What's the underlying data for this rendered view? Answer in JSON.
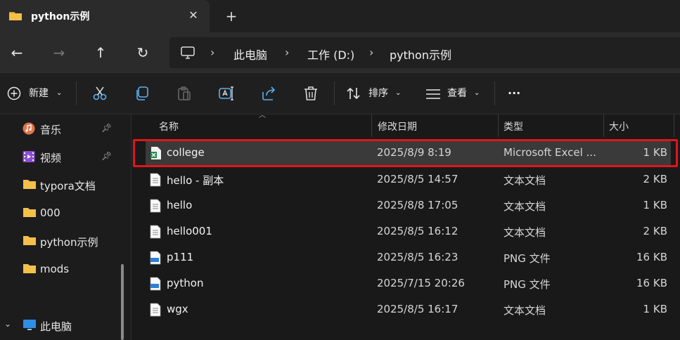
{
  "tab": {
    "title": "python示例",
    "close": "✕",
    "new": "+"
  },
  "nav": {
    "back": "←",
    "forward": "→",
    "up": "↑",
    "refresh": "↻"
  },
  "breadcrumb": {
    "items": [
      "此电脑",
      "工作 (D:)",
      "python示例"
    ],
    "sep": "›"
  },
  "toolbar": {
    "new_label": "新建",
    "sort_label": "排序",
    "view_label": "查看",
    "more": "···"
  },
  "sidebar": {
    "items": [
      {
        "label": "音乐",
        "icon": "music-icon",
        "pinned": true
      },
      {
        "label": "视频",
        "icon": "video-icon",
        "pinned": true
      },
      {
        "label": "typora文档",
        "icon": "folder-icon",
        "pinned": false
      },
      {
        "label": "000",
        "icon": "folder-icon",
        "pinned": false
      },
      {
        "label": "python示例",
        "icon": "folder-icon",
        "pinned": false
      },
      {
        "label": "mods",
        "icon": "folder-icon",
        "pinned": false
      }
    ],
    "this_pc": "此电脑"
  },
  "columns": {
    "name": "名称",
    "date": "修改日期",
    "type": "类型",
    "size": "大小"
  },
  "files": [
    {
      "name": "college",
      "date": "2025/8/9 8:19",
      "type": "Microsoft Excel ...",
      "size": "1 KB",
      "icon": "excel-file-icon",
      "selected": true
    },
    {
      "name": "hello - 副本",
      "date": "2025/8/5 14:57",
      "type": "文本文档",
      "size": "2 KB",
      "icon": "text-file-icon"
    },
    {
      "name": "hello",
      "date": "2025/8/8 17:05",
      "type": "文本文档",
      "size": "1 KB",
      "icon": "text-file-icon"
    },
    {
      "name": "hello001",
      "date": "2025/8/5 16:12",
      "type": "文本文档",
      "size": "2 KB",
      "icon": "text-file-icon"
    },
    {
      "name": "p111",
      "date": "2025/8/5 16:23",
      "type": "PNG 文件",
      "size": "16 KB",
      "icon": "png-file-icon"
    },
    {
      "name": "python",
      "date": "2025/7/15 20:26",
      "type": "PNG 文件",
      "size": "16 KB",
      "icon": "png-file-icon"
    },
    {
      "name": "wgx",
      "date": "2025/8/5 16:17",
      "type": "文本文档",
      "size": "1 KB",
      "icon": "text-file-icon"
    }
  ],
  "colors": {
    "accent": "#e2141d",
    "folder": "#f3c14a"
  }
}
